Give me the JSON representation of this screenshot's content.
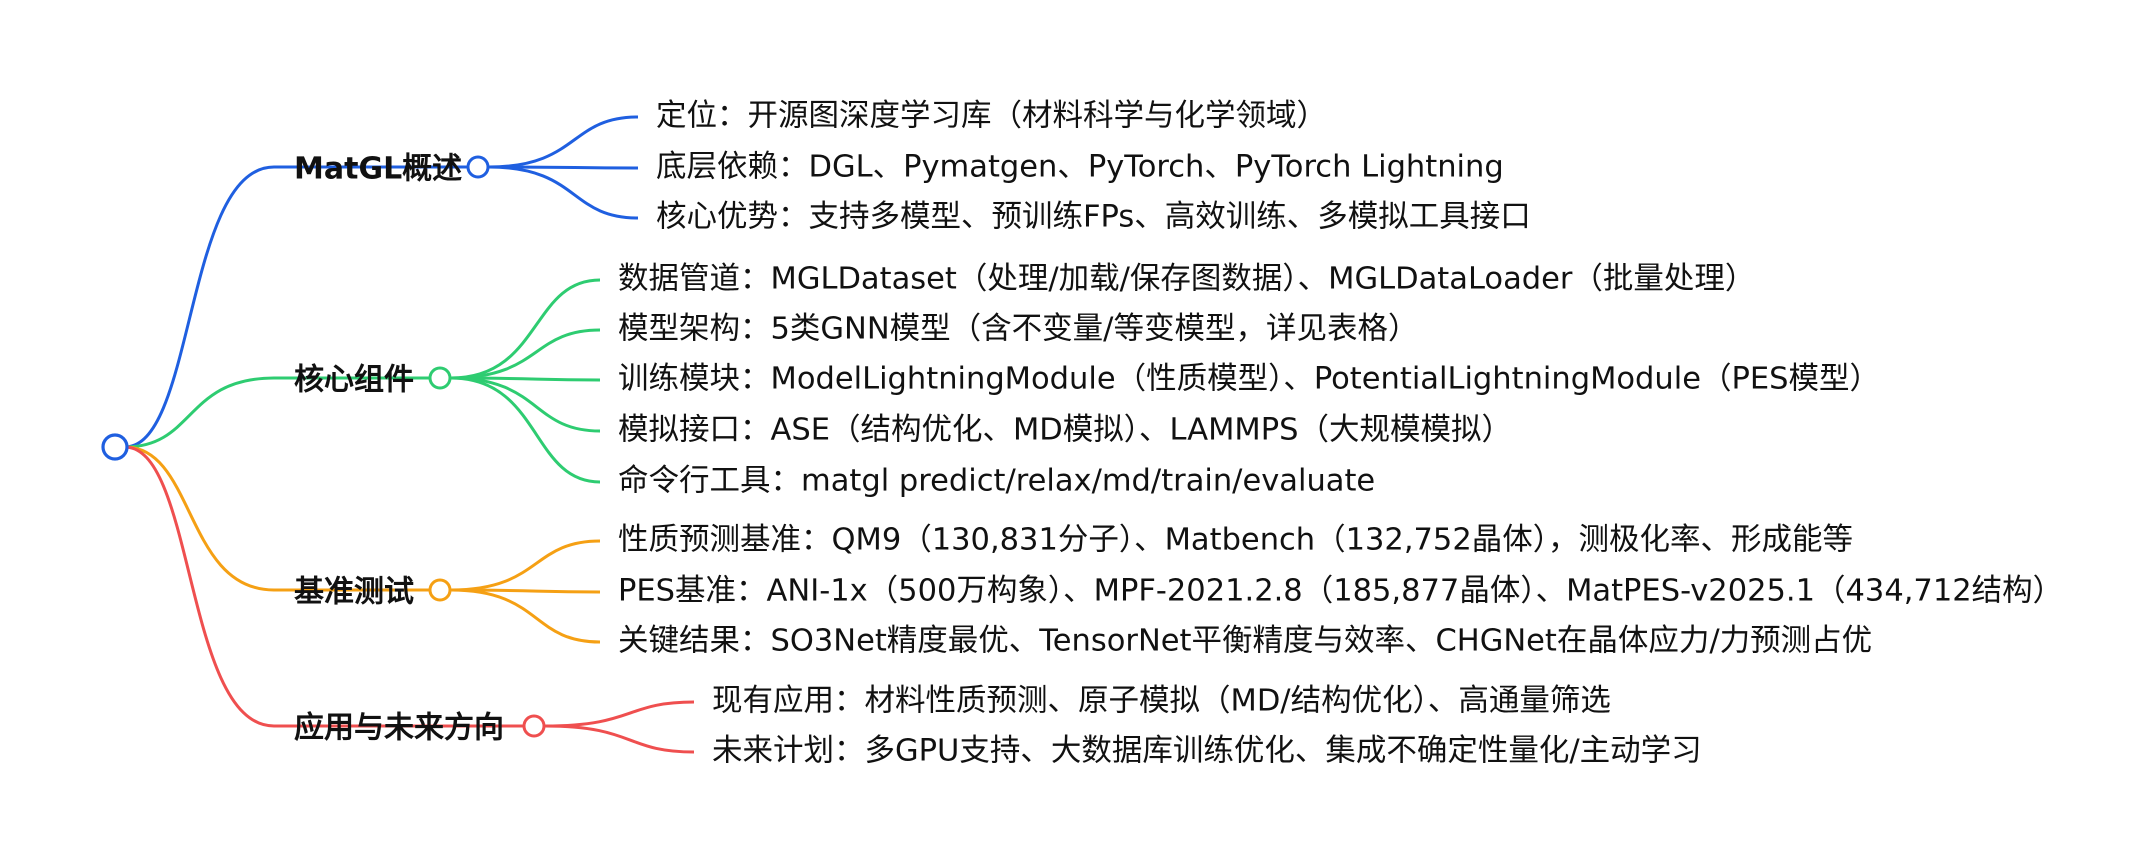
{
  "mindmap": {
    "branches": [
      {
        "label": "MatGL概述",
        "color": "#1f5fe0",
        "leaves": [
          "定位：开源图深度学习库（材料科学与化学领域）",
          "底层依赖：DGL、Pymatgen、PyTorch、PyTorch Lightning",
          "核心优势：支持多模型、预训练FPs、高效训练、多模拟工具接口"
        ]
      },
      {
        "label": "核心组件",
        "color": "#2ecc71",
        "leaves": [
          "数据管道：MGLDataset（处理/加载/保存图数据）、MGLDataLoader（批量处理）",
          "模型架构：5类GNN模型（含不变量/等变模型，详见表格）",
          "训练模块：ModelLightningModule（性质模型）、PotentialLightningModule（PES模型）",
          "模拟接口：ASE（结构优化、MD模拟）、LAMMPS（大规模模拟）",
          "命令行工具：matgl predict/relax/md/train/evaluate"
        ]
      },
      {
        "label": "基准测试",
        "color": "#f5a014",
        "leaves": [
          "性质预测基准：QM9（130,831分子）、Matbench（132,752晶体），测极化率、形成能等",
          "PES基准：ANI-1x（500万构象）、MPF-2021.2.8（185,877晶体）、MatPES-v2025.1（434,712结构）",
          "关键结果：SO3Net精度最优、TensorNet平衡精度与效率、CHGNet在晶体应力/力预测占优"
        ]
      },
      {
        "label": "应用与未来方向",
        "color": "#ef4f4f",
        "leaves": [
          "现有应用：材料性质预测、原子模拟（MD/结构优化）、高通量筛选",
          "未来计划：多GPU支持、大数据库训练优化、集成不确定性量化/主动学习"
        ]
      }
    ]
  }
}
